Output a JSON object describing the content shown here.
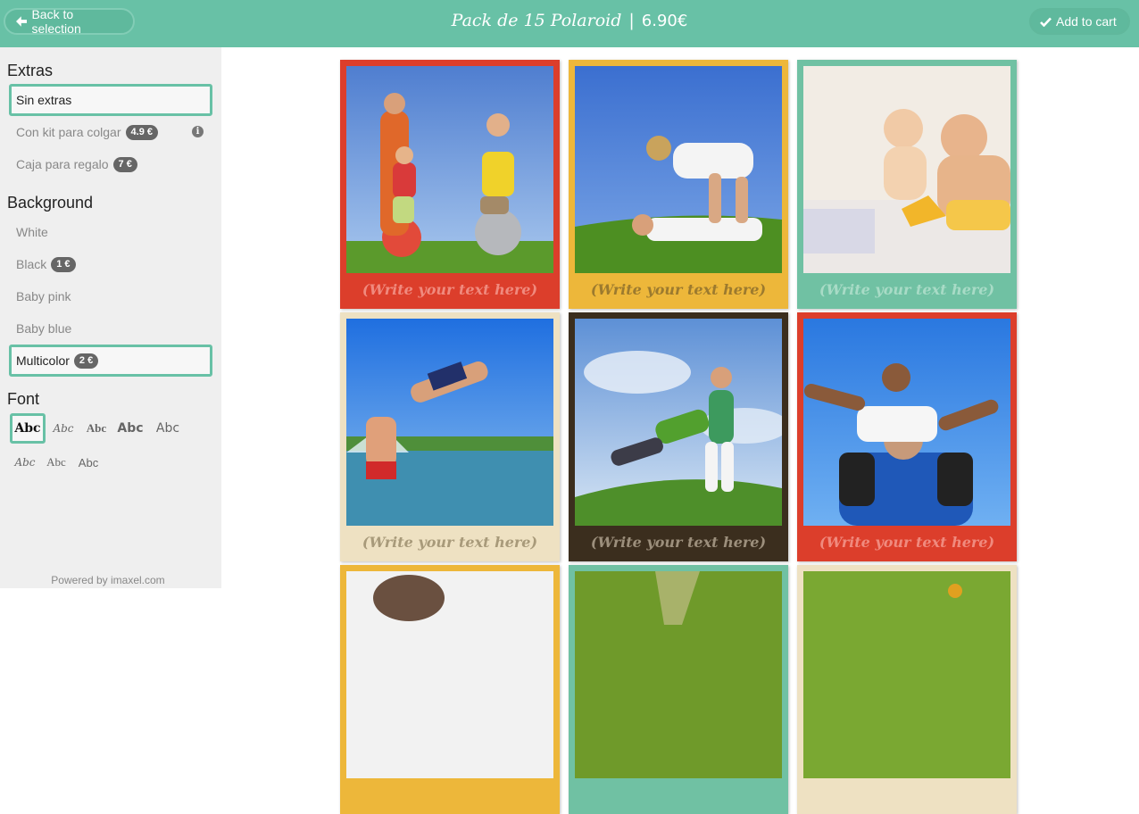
{
  "header": {
    "back_label": "Back to selection",
    "title": "Pack de 15 Polaroid",
    "separator": "|",
    "price": "6.90€",
    "cart_label": "Add to cart",
    "color": "#68c1a6"
  },
  "sidebar": {
    "extras_title": "Extras",
    "extras": [
      {
        "label": "Sin extras",
        "badge": "",
        "selected": true
      },
      {
        "label": "Con kit para colgar",
        "badge": "4.9 €",
        "selected": false
      },
      {
        "label": "Caja para regalo",
        "badge": "7 €",
        "selected": false
      }
    ],
    "info_icon": "i",
    "background_title": "Background",
    "backgrounds": [
      {
        "label": "White",
        "badge": ""
      },
      {
        "label": "Black",
        "badge": "1 €"
      },
      {
        "label": "Baby pink",
        "badge": ""
      },
      {
        "label": "Baby blue",
        "badge": ""
      },
      {
        "label": "Multicolor",
        "badge": "2 €",
        "selected": true
      }
    ],
    "font_title": "Font",
    "font_samples": [
      "Abc",
      "Abc",
      "Abc",
      "Abc",
      "Abc",
      "Abc",
      "Abc",
      "Abc"
    ],
    "powered": "Powered by imaxel.com"
  },
  "cards": [
    {
      "color": "red",
      "caption": "(Write your text here)",
      "photo": "family-with-bouncing-balls"
    },
    {
      "color": "yellow",
      "caption": "(Write your text here)",
      "photo": "couple-on-grass"
    },
    {
      "color": "teal",
      "caption": "(Write your text here)",
      "photo": "father-feeding-baby"
    },
    {
      "color": "cream",
      "caption": "(Write your text here)",
      "photo": "boy-jumping-into-sea"
    },
    {
      "color": "brown",
      "caption": "(Write your text here)",
      "photo": "mother-swinging-child"
    },
    {
      "color": "red",
      "caption": "(Write your text here)",
      "photo": "boy-on-fathers-shoulders"
    },
    {
      "color": "yellow",
      "caption": "",
      "photo": "portrait"
    },
    {
      "color": "teal",
      "caption": "",
      "photo": "grass-path"
    },
    {
      "color": "cream",
      "caption": "",
      "photo": "meadow"
    }
  ]
}
